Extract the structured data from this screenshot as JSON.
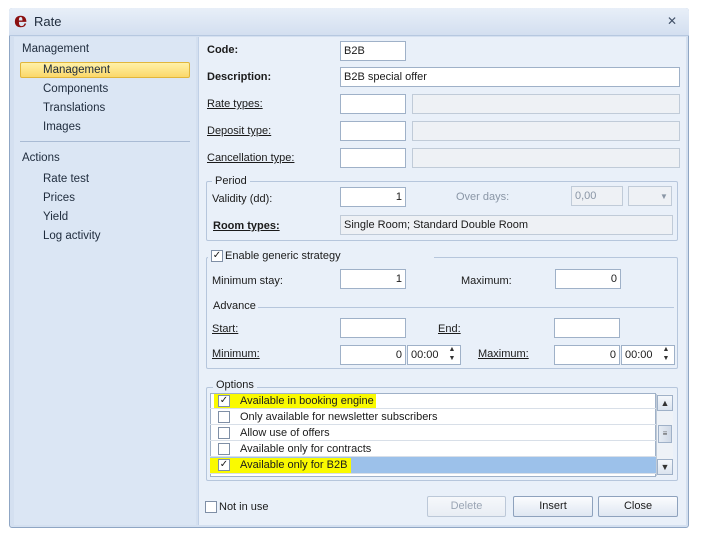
{
  "window": {
    "title": "Rate",
    "logo": "e",
    "close_glyph": "✕"
  },
  "nav": {
    "management_header": "Management",
    "management_items": [
      "Management",
      "Components",
      "Translations",
      "Images"
    ],
    "actions_header": "Actions",
    "actions_items": [
      "Rate test",
      "Prices",
      "Yield",
      "Log activity"
    ]
  },
  "form": {
    "code_label": "Code:",
    "code_value": "B2B",
    "description_label": "Description:",
    "description_value": "B2B special offer",
    "rate_types_label": "Rate types:",
    "deposit_type_label": "Deposit type:",
    "cancellation_type_label": "Cancellation type:",
    "period": {
      "title": "Period",
      "validity_label": "Validity (dd):",
      "validity_value": "1",
      "over_days_label": "Over days:",
      "over_days_value": "0,00",
      "room_types_label": "Room types:",
      "room_types_value": "Single Room; Standard Double Room"
    },
    "generic": {
      "title": "Enable generic strategy",
      "checked": true,
      "min_stay_label": "Minimum stay:",
      "min_stay_value": "1",
      "maximum_label": "Maximum:",
      "maximum_value": "0",
      "advance_title": "Advance",
      "start_label": "Start:",
      "end_label": "End:",
      "minimum_label": "Minimum:",
      "minimum_value": "0",
      "minimum_time": "00:00",
      "maximum2_label": "Maximum:",
      "maximum2_value": "0",
      "maximum2_time": "00:00"
    },
    "options": {
      "title": "Options",
      "items": [
        {
          "label": "Available in booking engine",
          "checked": true
        },
        {
          "label": "Only available for newsletter subscribers",
          "checked": false
        },
        {
          "label": "Allow use of offers",
          "checked": false
        },
        {
          "label": "Available only for contracts",
          "checked": false
        },
        {
          "label": "Available only for B2B",
          "checked": true
        }
      ]
    },
    "not_in_use_label": "Not in use"
  },
  "buttons": {
    "delete": "Delete",
    "insert": "Insert",
    "close": "Close"
  },
  "colors": {
    "highlight": "#fafa00",
    "nav_active": "#fbd86a",
    "selected_row": "#9cc1ea"
  }
}
